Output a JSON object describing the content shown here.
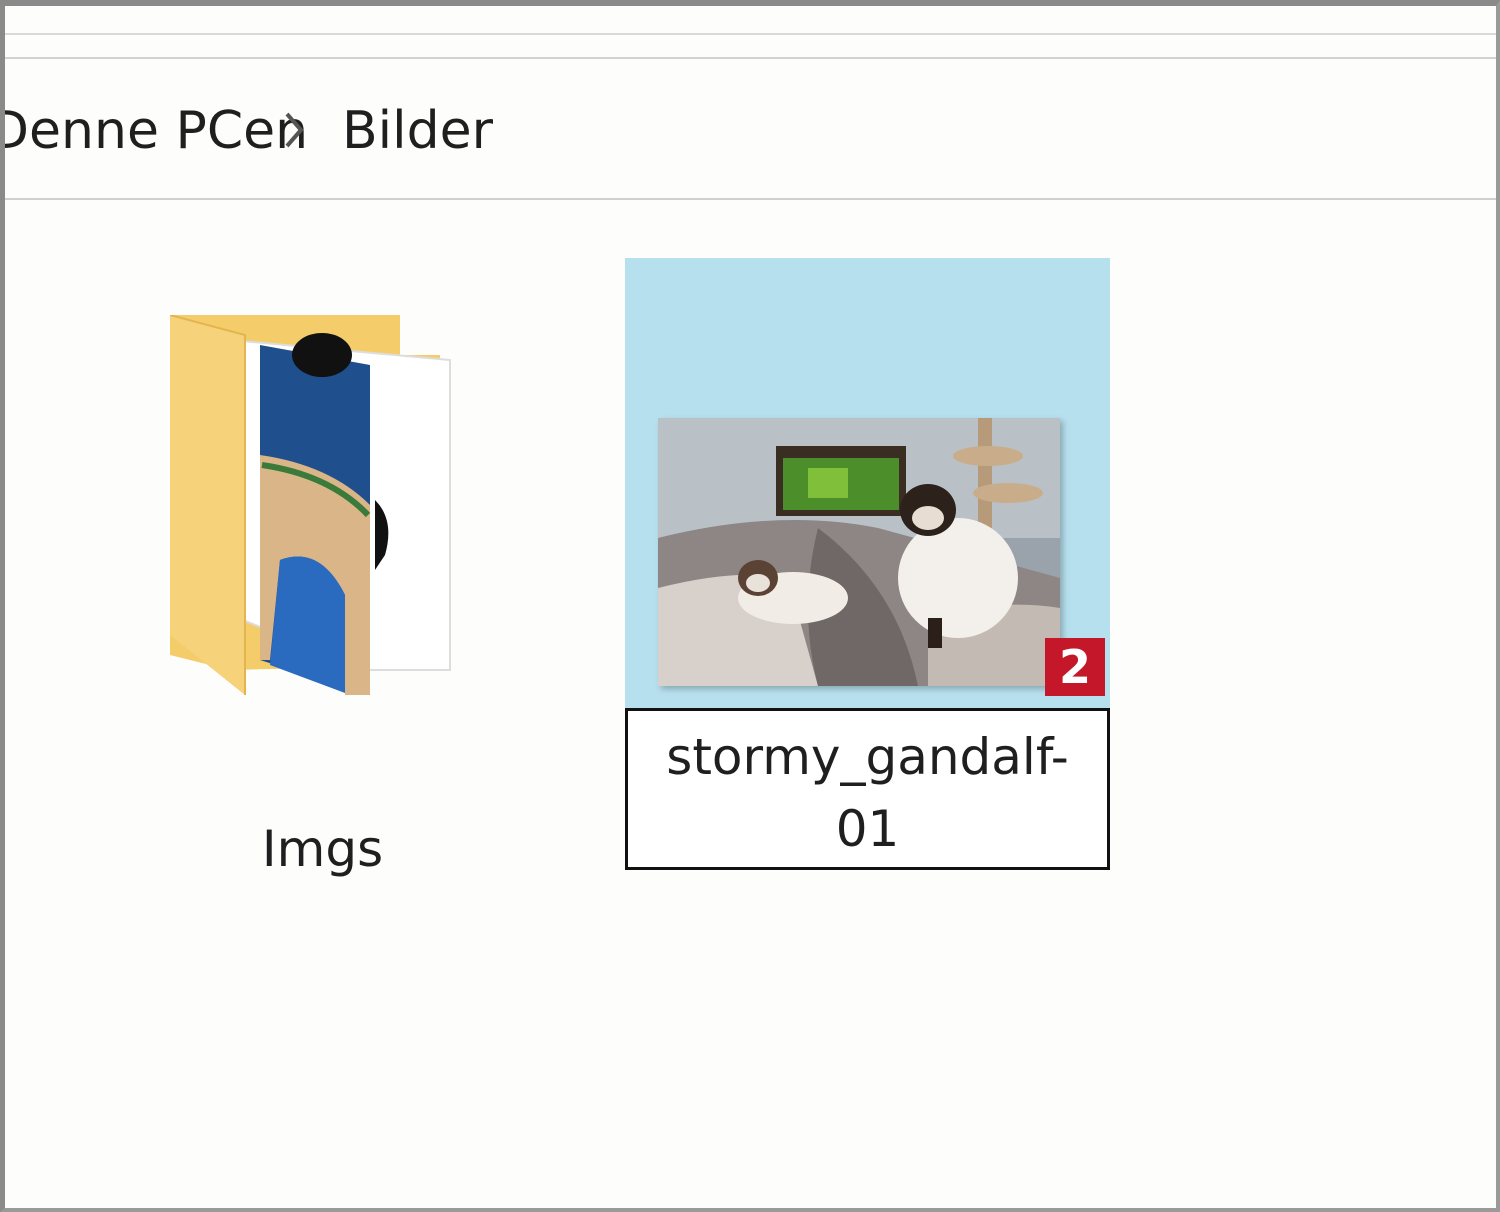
{
  "breadcrumb": {
    "previous": "Denne PCen",
    "separator_icon": "chevron-right-icon",
    "current": "Bilder"
  },
  "items": [
    {
      "type": "folder",
      "name": "Imgs",
      "icon": "folder-icon"
    },
    {
      "type": "image-file",
      "name_line1": "stormy_gandalf-",
      "name_line2": "01",
      "selected": true,
      "renaming": true,
      "badge": "2",
      "thumbnail": "cats-photo-thumbnail"
    }
  ],
  "colors": {
    "selection": "#b7e0ee",
    "badge": "#c4182a",
    "folder": "#f4cd6a"
  }
}
